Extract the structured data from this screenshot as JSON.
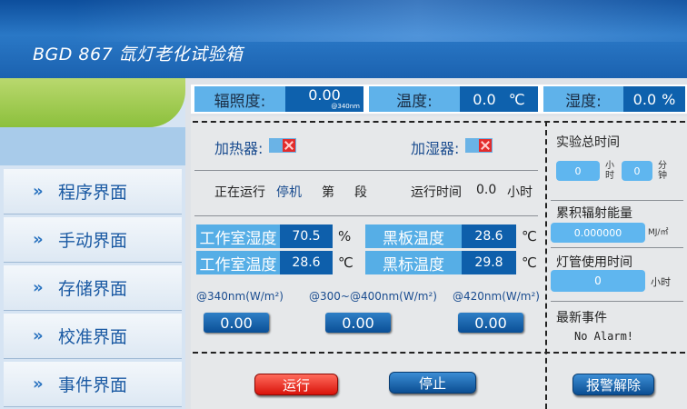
{
  "app": {
    "title": "BGD 867 氙灯老化试验箱"
  },
  "sidebar": {
    "items": [
      {
        "label": "程序界面"
      },
      {
        "label": "手动界面"
      },
      {
        "label": "存储界面"
      },
      {
        "label": "校准界面"
      },
      {
        "label": "事件界面"
      }
    ]
  },
  "status": {
    "irradiance_label": "辐照度:",
    "irradiance_value": "0.00",
    "irradiance_sub": "@340nm",
    "temp_label": "温度:",
    "temp_value": "0.0",
    "temp_unit": "℃",
    "humidity_label": "湿度:",
    "humidity_value": "0.0",
    "humidity_unit": "%"
  },
  "controls": {
    "heater_label": "加热器:",
    "humidifier_label": "加湿器:",
    "running_label": "正在运行",
    "running_state": "停机",
    "stage_prefix": "第",
    "stage_suffix": "段",
    "runtime_label": "运行时间",
    "runtime_value": "0.0",
    "runtime_unit": "小时"
  },
  "measurements": {
    "chamber_humidity_label": "工作室湿度",
    "chamber_humidity_value": "70.5",
    "chamber_humidity_unit": "%",
    "chamber_temp_label": "工作室温度",
    "chamber_temp_value": "28.6",
    "chamber_temp_unit": "℃",
    "black_panel_label": "黑板温度",
    "black_panel_value": "28.6",
    "black_panel_unit": "℃",
    "black_standard_label": "黑标温度",
    "black_standard_value": "29.8",
    "black_standard_unit": "℃"
  },
  "wavelengths": [
    {
      "label": "@340nm(W/m²)",
      "value": "0.00"
    },
    {
      "label": "@300~@400nm(W/m²)",
      "value": "0.00"
    },
    {
      "label": "@420nm(W/m²)",
      "value": "0.00"
    }
  ],
  "buttons": {
    "run": "运行",
    "stop": "停止",
    "clear_alarm": "报警解除"
  },
  "right_panel": {
    "total_time_label": "实验总时间",
    "hours_value": "0",
    "hours_unit": "小时",
    "minutes_value": "0",
    "minutes_unit": "分钟",
    "energy_label": "累积辐射能量",
    "energy_value": "0.000000",
    "energy_unit": "MJ/㎡",
    "lamp_label": "灯管使用时间",
    "lamp_value": "0",
    "lamp_unit": "小时",
    "event_label": "最新事件",
    "event_value": "No Alarm!"
  },
  "colors": {
    "header": "#1b62b0",
    "label_blue": "#56aee6",
    "value_blue": "#0e5fab",
    "run_red": "#d9130a",
    "accent_green": "#8cc03c"
  }
}
